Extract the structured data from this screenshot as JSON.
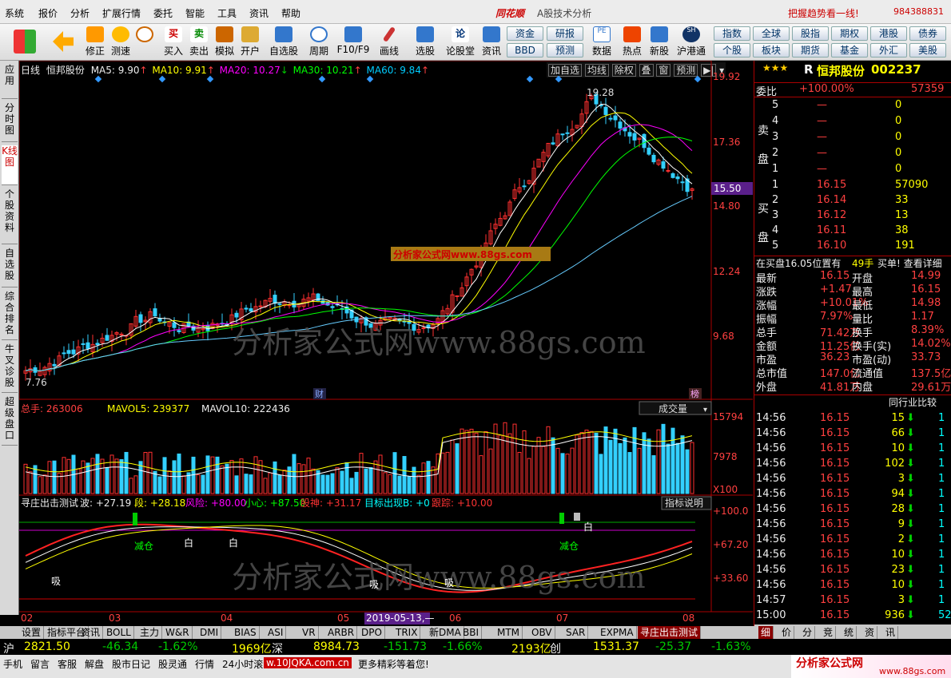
{
  "menu": {
    "items": [
      "系统",
      "报价",
      "分析",
      "扩展行情",
      "委托",
      "智能",
      "工具",
      "资讯",
      "帮助"
    ],
    "brand": "同花顺",
    "subtitle": "A股技术分析",
    "slogan": "把握趋势看一线!",
    "phone": "984388831"
  },
  "toolbar": {
    "left": [
      "修正",
      "测速",
      "买入",
      "卖出",
      "模拟",
      "开户",
      "自选股",
      "周期",
      "F10/F9",
      "画线",
      "选股",
      "论股堂",
      "资讯",
      "数据",
      "热点",
      "新股",
      "沪港通"
    ],
    "grid": [
      "资金",
      "研报",
      "BBD",
      "预测",
      "指数",
      "全球",
      "股指",
      "期权",
      "港股",
      "债券",
      "个股",
      "板块",
      "期货",
      "基金",
      "外汇",
      "美股"
    ]
  },
  "left_tabs": [
    "应用",
    "分时图",
    "K线图",
    "个股资料",
    "自选股",
    "综合排名",
    "牛叉诊股",
    "超级盘口"
  ],
  "chart": {
    "period": "日线",
    "name": "恒邦股份",
    "ma5": "MA5: 9.90",
    "ma10": "MA10: 9.91",
    "ma20": "MA20: 10.27",
    "ma30": "MA30: 10.21",
    "ma60": "MA60: 9.84",
    "buttons": [
      "加自选",
      "均线",
      "除权",
      "叠",
      "窗",
      "预测"
    ],
    "price_ticks": [
      "19.92",
      "17.36",
      "14.80",
      "12.24",
      "9.68"
    ],
    "current_price": "15.50",
    "high_label": "19.28",
    "low_label": "7.76",
    "ad_label": "分析家公式网www.88gs.com",
    "watermark": "分析家公式网www.88gs.com",
    "mark_cai": "财",
    "mark_bang": "榜",
    "vol_title": "总手: 263006",
    "mavol5": "MAVOL5: 239377",
    "mavol10": "MAVOL10: 222436",
    "vol_select": "成交量",
    "vol_ticks": [
      "15794",
      "7978",
      "X100"
    ],
    "ind_title": "寻庄出击测试",
    "ind_vals": [
      "波: +27.19",
      "段: +28.18",
      "风险: +80.00",
      "小心: +87.50",
      "股神: +31.17",
      "目标出现B: +0",
      "跟踪: +10.00"
    ],
    "ind_btn": "指标说明",
    "ind_ticks": [
      "+100.0",
      "+67.20",
      "+33.60"
    ],
    "sig_jiancang": "减仓",
    "sig_xi": "吸",
    "sig_bai": "白",
    "xlabels": [
      "02",
      "03",
      "04",
      "05",
      "06",
      "07",
      "08"
    ],
    "cursor_date": "2019-05-13,—"
  },
  "stock": {
    "stars": "★★★",
    "tag": "R",
    "name": "恒邦股份",
    "code": "002237",
    "weibi_label": "委比",
    "weibi": "+100.00%",
    "weibi_r": "57359",
    "sell_label": "卖盘",
    "buy_label": "买盘",
    "sell": [
      [
        "5",
        "—",
        "0"
      ],
      [
        "4",
        "—",
        "0"
      ],
      [
        "3",
        "—",
        "0"
      ],
      [
        "2",
        "—",
        "0"
      ],
      [
        "1",
        "—",
        "0"
      ]
    ],
    "buy": [
      [
        "1",
        "16.15",
        "57090"
      ],
      [
        "2",
        "16.14",
        "33"
      ],
      [
        "3",
        "16.12",
        "13"
      ],
      [
        "4",
        "16.11",
        "38"
      ],
      [
        "5",
        "16.10",
        "191"
      ]
    ],
    "note": "在买盘16.05位置有",
    "note_vol": "49手",
    "note_r": "买单! 查看详细",
    "quote": [
      [
        "最新",
        "16.15",
        "开盘",
        "14.99"
      ],
      [
        "涨跌",
        "+1.47",
        "最高",
        "16.15"
      ],
      [
        "涨幅",
        "+10.01%",
        "最低",
        "14.98"
      ],
      [
        "振幅",
        "7.97%",
        "量比",
        "1.17"
      ],
      [
        "总手",
        "71.42万",
        "换手",
        "8.39%"
      ],
      [
        "金额",
        "11.25亿",
        "换手(实)",
        "14.02%"
      ],
      [
        "市盈",
        "36.23",
        "市盈(动)",
        "33.73"
      ],
      [
        "总市值",
        "147.0亿",
        "流通值",
        "137.5亿"
      ],
      [
        "外盘",
        "41.81万",
        "内盘",
        "29.61万"
      ]
    ],
    "cmp": "同行业比较",
    "ticks": [
      [
        "14:56",
        "16.15",
        "15"
      ],
      [
        "14:56",
        "16.15",
        "66"
      ],
      [
        "14:56",
        "16.15",
        "10"
      ],
      [
        "14:56",
        "16.15",
        "102"
      ],
      [
        "14:56",
        "16.15",
        "3"
      ],
      [
        "14:56",
        "16.15",
        "94"
      ],
      [
        "14:56",
        "16.15",
        "28"
      ],
      [
        "14:56",
        "16.15",
        "9"
      ],
      [
        "14:56",
        "16.15",
        "2"
      ],
      [
        "14:56",
        "16.15",
        "10"
      ],
      [
        "14:56",
        "16.15",
        "23"
      ],
      [
        "14:56",
        "16.15",
        "10"
      ],
      [
        "14:57",
        "16.15",
        "3"
      ],
      [
        "15:00",
        "16.15",
        "936"
      ]
    ],
    "tick_r": [
      "1",
      "1",
      "1",
      "1",
      "1",
      "1",
      "1",
      "1",
      "1",
      "1",
      "1",
      "1",
      "1",
      "52"
    ]
  },
  "bottom_tabs": [
    "设置",
    "指标平台",
    "资讯",
    "BOLL",
    "主力",
    "W&R",
    "DMI",
    "BIAS",
    "ASI",
    "VR",
    "ARBR",
    "DPO",
    "TRIX",
    "新DMA",
    "BBI",
    "MTM",
    "OBV",
    "SAR",
    "EXPMA",
    "寻庄出击测试"
  ],
  "right_tabs": [
    "细",
    "价",
    "分",
    "竞",
    "统",
    "资",
    "讯"
  ],
  "index": {
    "sh": "沪",
    "sh_v": "2821.50",
    "sh_c": "-46.34",
    "sh_p": "-1.62%",
    "sh_a": "1969亿",
    "sz": "深",
    "sz_v": "8984.73",
    "sz_c": "-151.73",
    "sz_p": "-1.66%",
    "sz_a": "2193亿",
    "cy": "创",
    "cy_v": "1531.37",
    "cy_c": "-25.37",
    "cy_p": "-1.63%"
  },
  "status": {
    "items": [
      "手机",
      "留言",
      "客服",
      "解盘",
      "股市日记",
      "股灵通",
      "行情",
      "24小时滚动"
    ],
    "link": "w.10JQKA.com.cn",
    "promo": "更多精彩等着您!",
    "logo": "分析家公式网",
    "logo_url": "www.88gs.com"
  }
}
